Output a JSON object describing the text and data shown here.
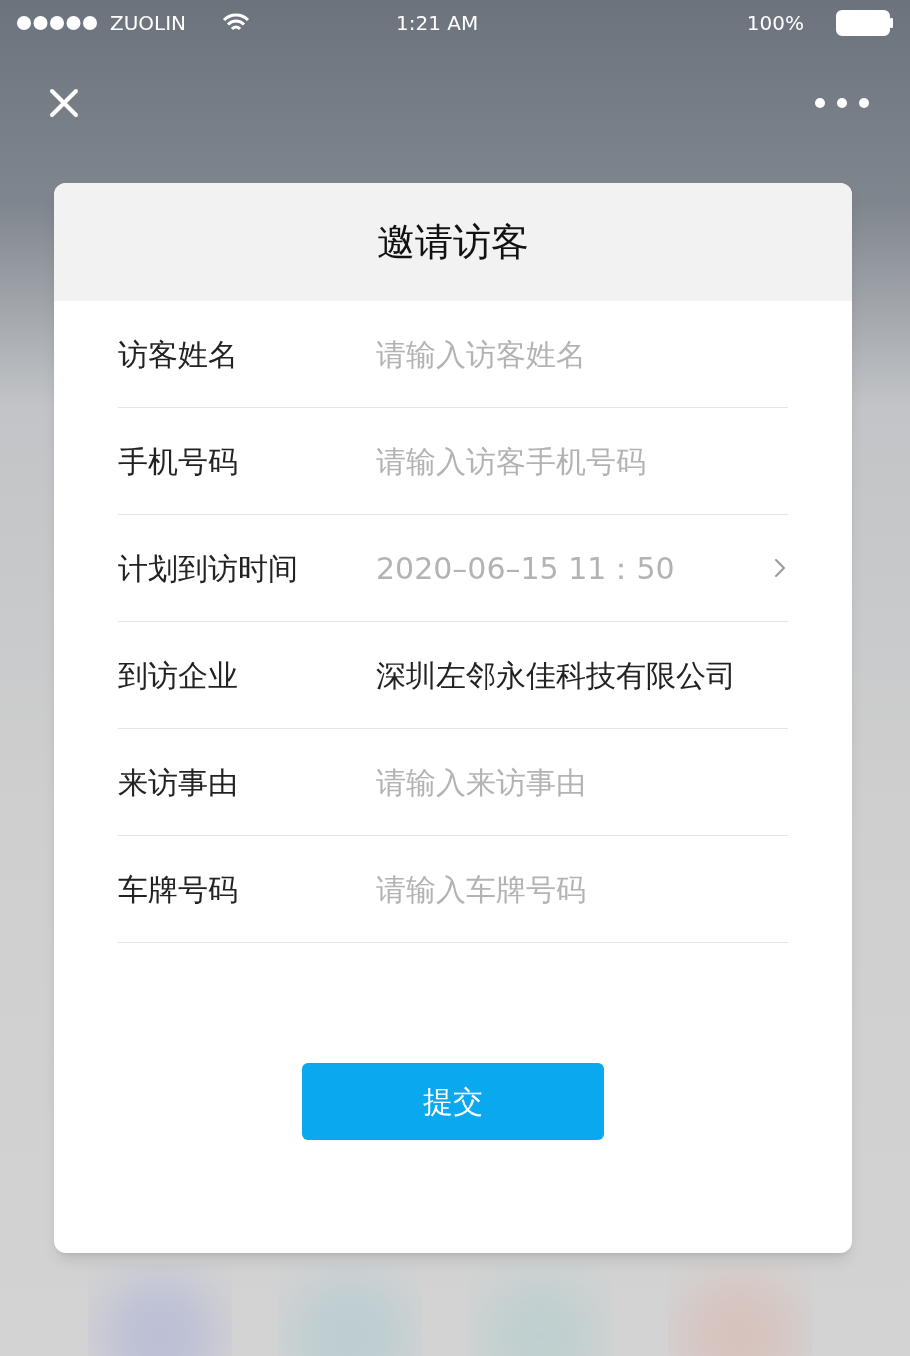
{
  "status_bar": {
    "carrier": "ZUOLIN",
    "time": "1:21 AM",
    "battery": "100%"
  },
  "dialog": {
    "title": "邀请访客",
    "fields": [
      {
        "kind": "input",
        "label": "访客姓名",
        "placeholder": "请输入访客姓名"
      },
      {
        "kind": "input",
        "label": "手机号码",
        "placeholder": "请输入访客手机号码"
      },
      {
        "kind": "picker",
        "label": "计划到访时间",
        "value": "2020–06–15 11：50"
      },
      {
        "kind": "static",
        "label": "到访企业",
        "value": "深圳左邻永佳科技有限公司"
      },
      {
        "kind": "input",
        "label": "来访事由",
        "placeholder": "请输入来访事由"
      },
      {
        "kind": "input",
        "label": "车牌号码",
        "placeholder": "请输入车牌号码"
      }
    ],
    "submit": "提交"
  }
}
